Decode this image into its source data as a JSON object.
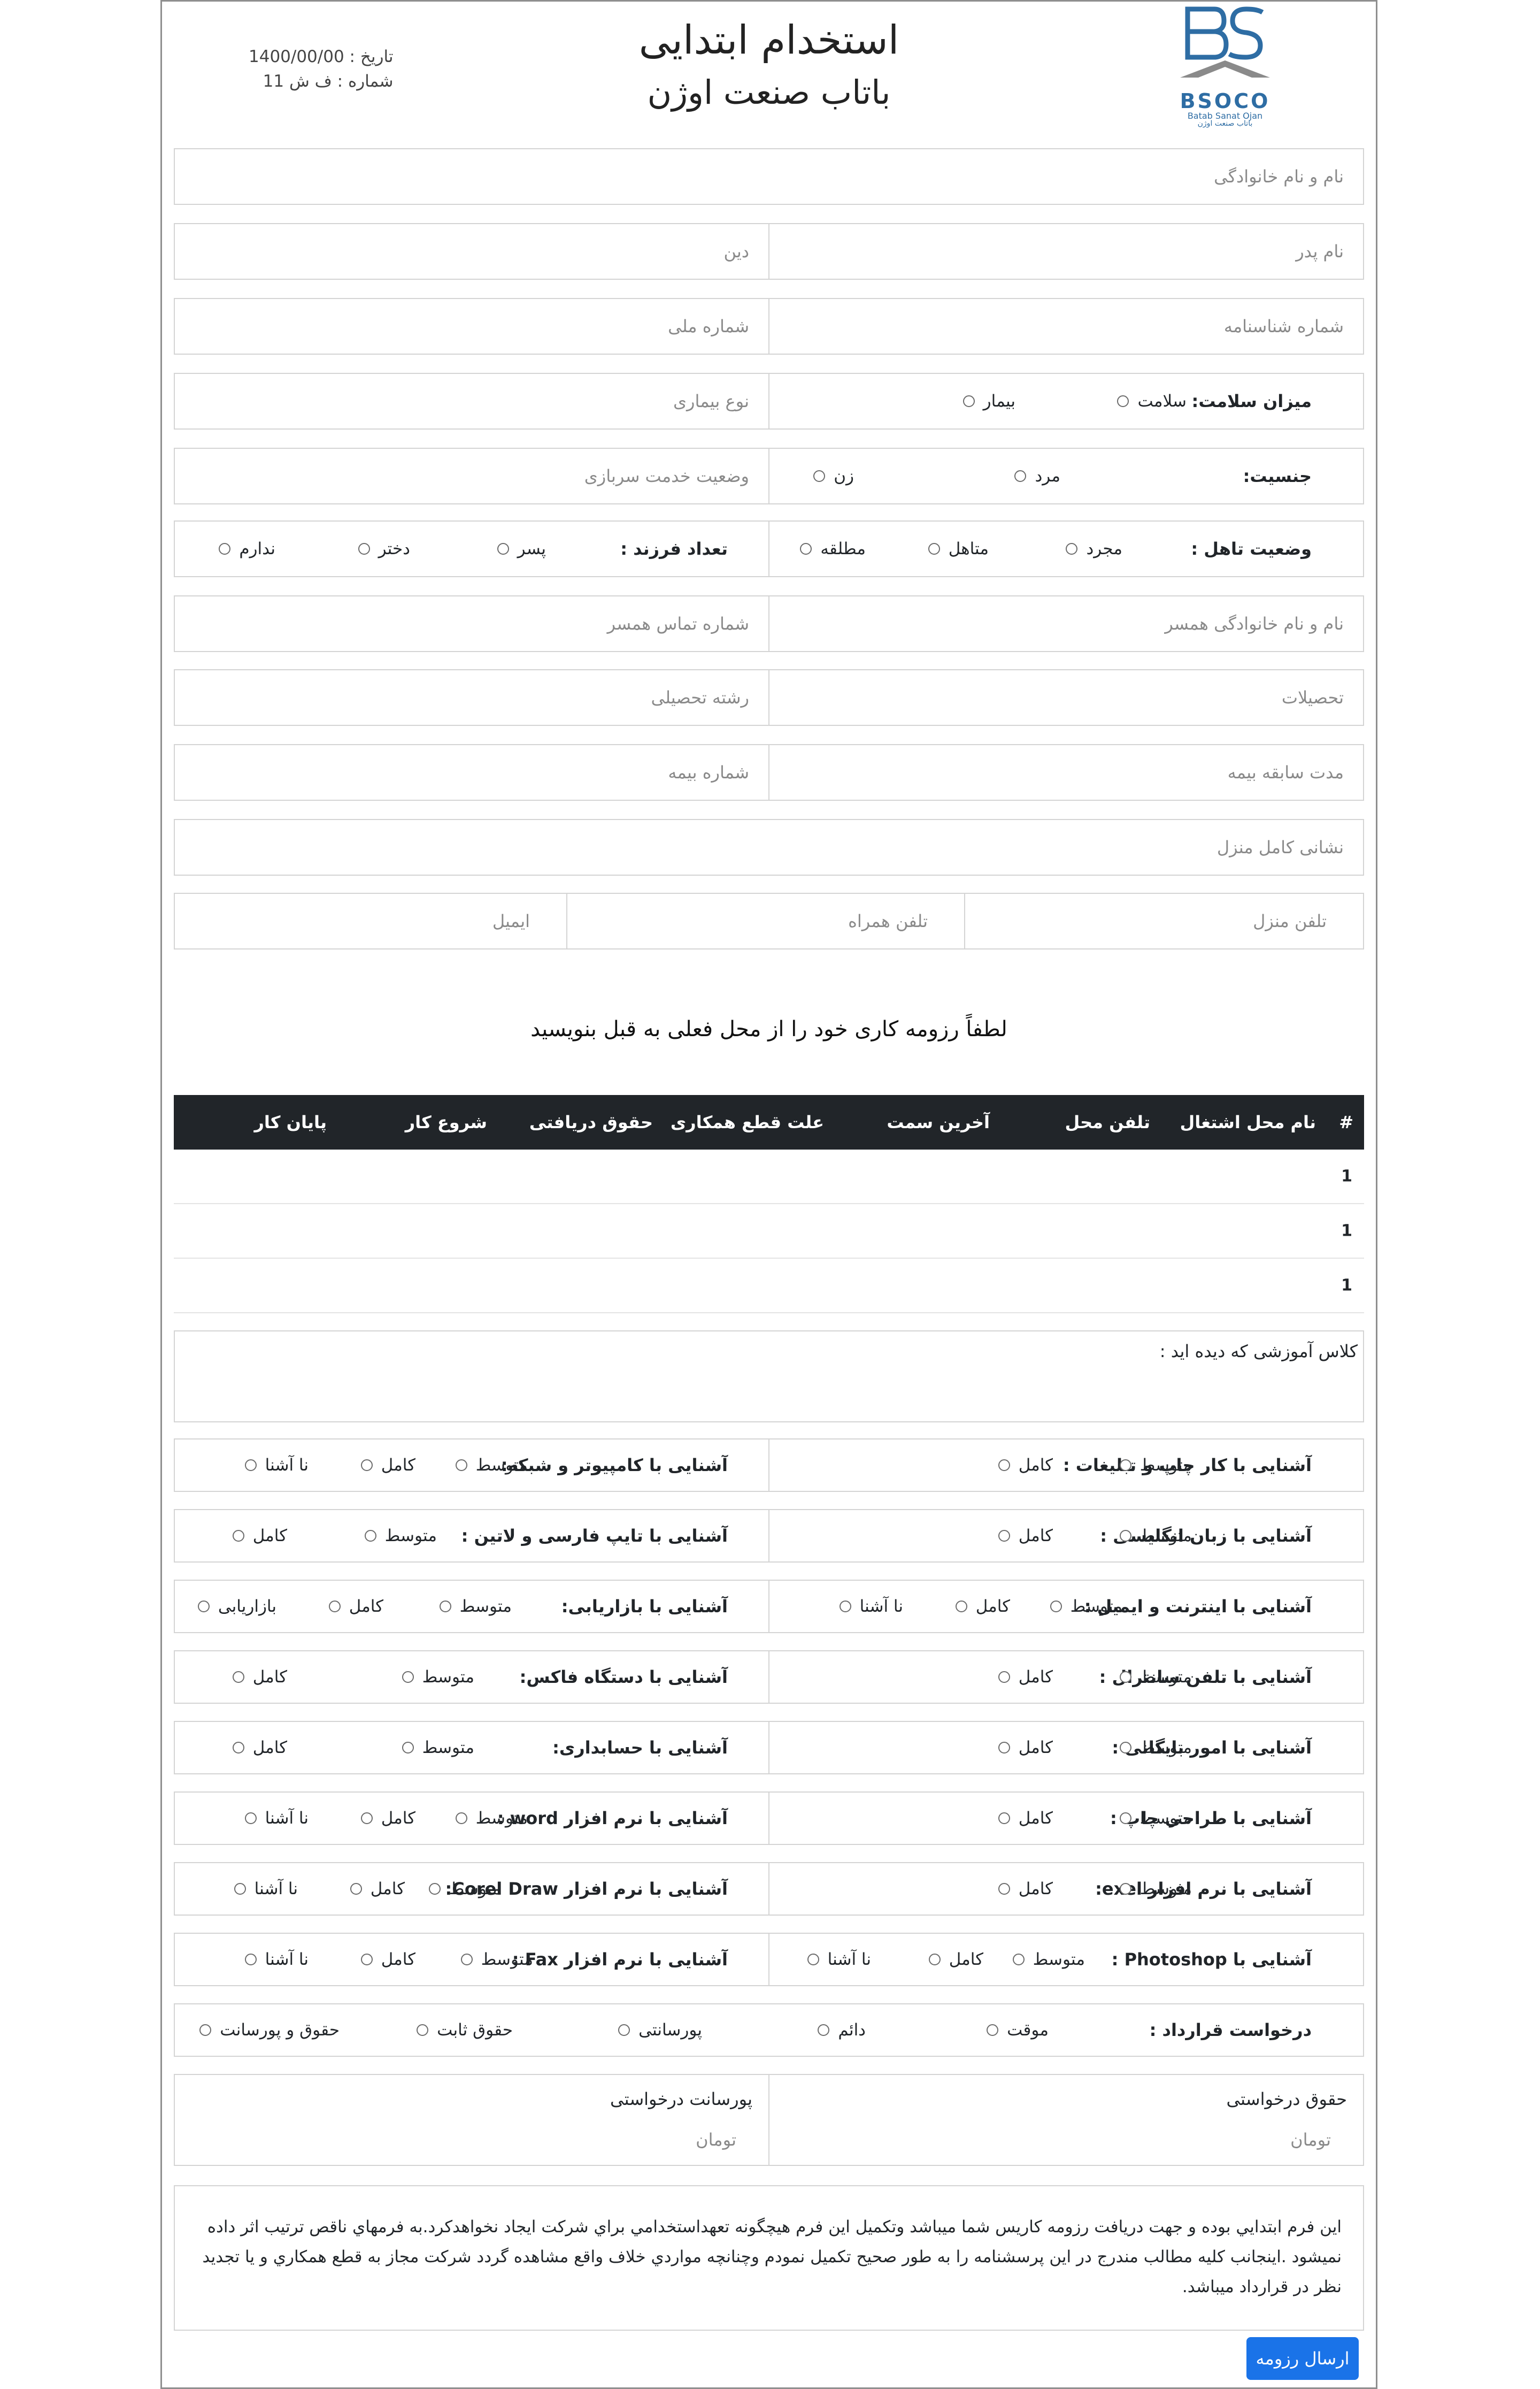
{
  "header": {
    "title": "استخدام ابتدایی",
    "company": "باتاب صنعت اوژن",
    "date": "تاریخ : 1400/00/00",
    "number": "شماره : ف ش 11",
    "logo": {
      "brand": "BSOCO",
      "sub_en": "Batab Sanat Ojan",
      "sub_fa": "باتاب صنعت اوژن"
    }
  },
  "fields": {
    "full_name": "نام و نام خانوادگی",
    "father_name": "نام پدر",
    "religion": "دین",
    "id_number": "شماره شناسنامه",
    "national_id": "شماره ملی",
    "disease_type": "نوع بیماری",
    "military": "وضعیت خدمت سربازی",
    "spouse_name": "نام و نام خانوادگی همسر",
    "spouse_phone": "شماره تماس همسر",
    "education": "تحصیلات",
    "field_of_study": "رشته تحصیلی",
    "insurance_years": "مدت سابقه بیمه",
    "insurance_no": "شماره بیمه",
    "address": "نشانی کامل منزل",
    "home_phone": "تلفن منزل",
    "mobile": "تلفن همراه",
    "email": "ایمیل"
  },
  "health": {
    "label": "میزان سلامت:",
    "opts": [
      "سلامت",
      "بیمار"
    ]
  },
  "gender": {
    "label": "جنسیت:",
    "opts": [
      "مرد",
      "زن"
    ]
  },
  "marital": {
    "label": "وضعیت تاهل :",
    "opts": [
      "مجرد",
      "متاهل",
      "مطلقه"
    ]
  },
  "children": {
    "label": "تعداد فرزند :",
    "opts": [
      "پسر",
      "دختر",
      "ندارم"
    ]
  },
  "resume": {
    "heading": "لطفاً رزومه کاری خود را از محل فعلی به قبل بنویسید",
    "columns": [
      "#",
      "نام محل اشتغال",
      "تلفن محل",
      "آخرین سمت",
      "علت قطع همکاری",
      "حقوق دریافتی",
      "شروع کار",
      "پایان کار"
    ],
    "rows": [
      "1",
      "1",
      "1"
    ]
  },
  "classes_label": "کلاس آموزشی که دیده اید :",
  "skills": [
    {
      "a": {
        "label": "آشنایی با کار چاپ و تبلیغات :",
        "opts": [
          "متوسط",
          "کامل"
        ]
      },
      "b": {
        "label": "آشنایی با کامپیوتر و شبکه:",
        "opts": [
          "متوسط",
          "کامل",
          "نا آشنا"
        ]
      }
    },
    {
      "a": {
        "label": "آشنایی با زبان انگلیسی :",
        "opts": [
          "متوسط",
          "کامل"
        ]
      },
      "b": {
        "label": "آشنایی با تایپ فارسی و لاتین :",
        "opts": [
          "متوسط",
          "کامل"
        ]
      }
    },
    {
      "a": {
        "label": "آشنایی با اینترنت و ایمیل :",
        "opts": [
          "متوسط",
          "کامل",
          "نا آشنا"
        ]
      },
      "b": {
        "label": "آشنایی با بازاریابی:",
        "opts": [
          "متوسط",
          "کامل",
          "بازاریابی"
        ]
      }
    },
    {
      "a": {
        "label": "آشنایی با تلفن سانترال :",
        "opts": [
          "متوسط",
          "کامل"
        ]
      },
      "b": {
        "label": "آشنایی با دستگاه فاکس:",
        "opts": [
          "متوسط",
          "کامل"
        ]
      }
    },
    {
      "a": {
        "label": "آشنایی با امور بایگانی :",
        "opts": [
          "متوسط",
          "کامل"
        ]
      },
      "b": {
        "label": "آشنایی با حسابداری:",
        "opts": [
          "متوسط",
          "کامل"
        ]
      }
    },
    {
      "a": {
        "label": "آشنایی با طراحی چاپ :",
        "opts": [
          "متوسط",
          "کامل"
        ]
      },
      "b": {
        "label": "آشنایی با نرم افزار word :",
        "opts": [
          "متوسط",
          "کامل",
          "نا آشنا"
        ]
      }
    },
    {
      "a": {
        "label": "آشنایی با نرم افزار exel:",
        "opts": [
          "متوسط",
          "کامل"
        ]
      },
      "b": {
        "label": "آشنایی با نرم افزار Corel Draw:",
        "opts": [
          "متوسط",
          "کامل",
          "نا آشنا"
        ]
      }
    },
    {
      "a": {
        "label": "آشنایی با Photoshop :",
        "opts": [
          "متوسط",
          "کامل",
          "نا آشنا"
        ]
      },
      "b": {
        "label": "آشنایی با نرم افزار Fax :",
        "opts": [
          "متوسط",
          "کامل",
          "نا آشنا"
        ]
      }
    }
  ],
  "contract": {
    "label": "درخواست قرارداد :",
    "opts": [
      "موقت",
      "دائم",
      "پورسانتی",
      "حقوق ثابت",
      "حقوق و پورسانت"
    ]
  },
  "salary": {
    "label": "حقوق درخواستی",
    "unit": "تومان"
  },
  "commission": {
    "label": "پورسانت درخواستی",
    "unit": "تومان"
  },
  "disclaimer": "این فرم ابتدايي بوده و جهت دريافت رزومه كاريس شما ميباشد وتكميل اين فرم هيچگونه تعهداستخدامي براي شركت ايجاد نخواهدكرد.به فرمهاي ناقص ترتيب اثر داده نميشود .اينجانب كليه مطالب مندرج در اين پرسشنامه را به طور صحيح تكميل نمودم وچنانچه مواردي خلاف واقع مشاهده گردد شركت مجاز به قطع همكاري و يا تجديد نظر در قرارداد ميباشد.",
  "submit": "ارسال رزومه",
  "colors": {
    "accent": "#1a73e8",
    "table_head": "#212529",
    "logo": "#2e6da4"
  }
}
